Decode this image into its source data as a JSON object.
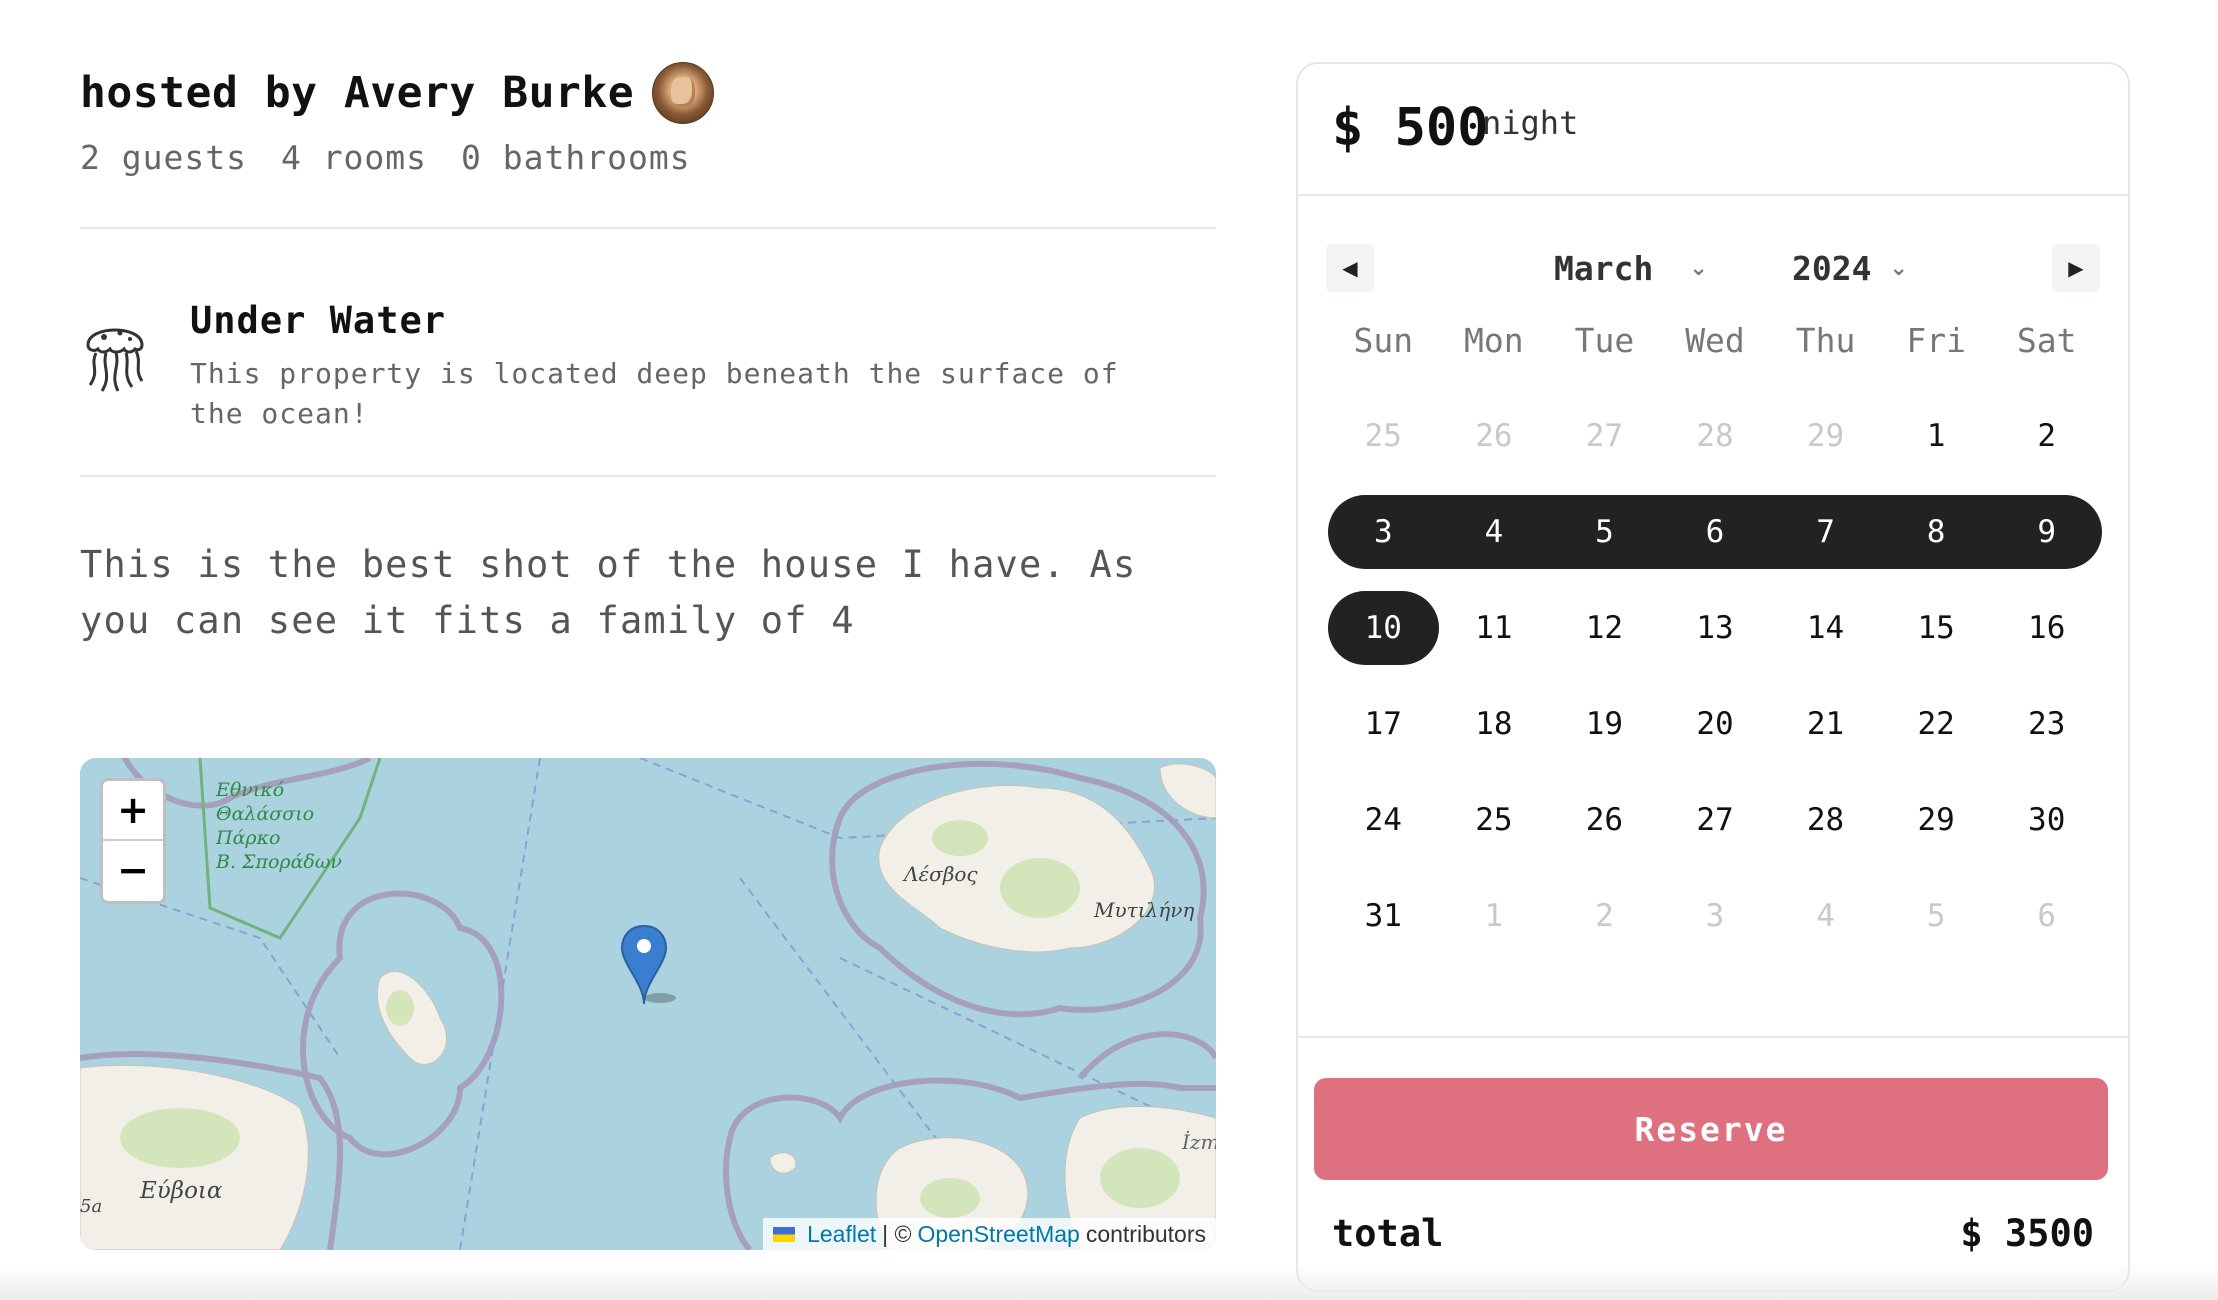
{
  "host": {
    "title": "hosted by Avery Burke",
    "avatar_icon": "host-avatar"
  },
  "stats": {
    "guests": "2 guests",
    "rooms": "4 rooms",
    "bathrooms": "0 bathrooms"
  },
  "feature": {
    "icon": "jellyfish-icon",
    "title": "Under Water",
    "description": "This property is located deep beneath the surface of the ocean!"
  },
  "description": "This is the best shot of the house I have. As you can see it fits a family of 4",
  "map": {
    "zoom_in": "+",
    "zoom_out": "−",
    "labels": {
      "park": [
        "Εθνικό",
        "Θαλάσσιο",
        "Πάρκο",
        "Β. Σποράδων"
      ],
      "lesvos": "Λέσβος",
      "mytilini": "Μυτιλήνη",
      "evia": "Εύβοια",
      "izm": "İzm",
      "sa": "5a"
    },
    "attribution": {
      "leaflet": "Leaflet",
      "sep": "| ©",
      "osm": "OpenStreetMap",
      "contributors": "contributors"
    }
  },
  "booking": {
    "currency": "$",
    "price": "500",
    "price_display": "$ 500",
    "unit": "night",
    "calendar": {
      "month": "March",
      "year": "2024",
      "weekdays": [
        "Sun",
        "Mon",
        "Tue",
        "Wed",
        "Thu",
        "Fri",
        "Sat"
      ],
      "weeks": [
        [
          "25",
          "26",
          "27",
          "28",
          "29",
          "1",
          "2"
        ],
        [
          "3",
          "4",
          "5",
          "6",
          "7",
          "8",
          "9"
        ],
        [
          "10",
          "11",
          "12",
          "13",
          "14",
          "15",
          "16"
        ],
        [
          "17",
          "18",
          "19",
          "20",
          "21",
          "22",
          "23"
        ],
        [
          "24",
          "25",
          "26",
          "27",
          "28",
          "29",
          "30"
        ],
        [
          "31",
          "1",
          "2",
          "3",
          "4",
          "5",
          "6"
        ]
      ],
      "selected_range": {
        "start": "3",
        "end": "10"
      }
    },
    "reserve_label": "Reserve",
    "total_label": "total",
    "total_value": "$ 3500"
  },
  "colors": {
    "accent": "#df707f",
    "selected": "#222222",
    "muted_text": "#666666",
    "water": "#aad3df"
  }
}
